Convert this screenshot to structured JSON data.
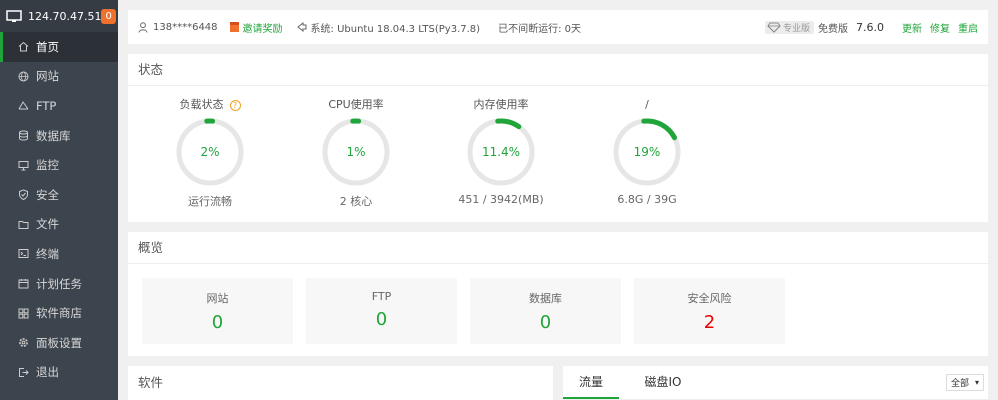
{
  "server": {
    "ip": "124.70.47.51",
    "badge": "0"
  },
  "sidebar": {
    "items": [
      {
        "label": "首页",
        "icon": "home-icon"
      },
      {
        "label": "网站",
        "icon": "globe-icon"
      },
      {
        "label": "FTP",
        "icon": "ftp-icon"
      },
      {
        "label": "数据库",
        "icon": "database-icon"
      },
      {
        "label": "监控",
        "icon": "monitor-icon"
      },
      {
        "label": "安全",
        "icon": "shield-icon"
      },
      {
        "label": "文件",
        "icon": "folder-icon"
      },
      {
        "label": "终端",
        "icon": "terminal-icon"
      },
      {
        "label": "计划任务",
        "icon": "calendar-icon"
      },
      {
        "label": "软件商店",
        "icon": "grid-icon"
      },
      {
        "label": "面板设置",
        "icon": "gear-icon"
      },
      {
        "label": "退出",
        "icon": "logout-icon"
      }
    ],
    "active_index": 0
  },
  "topbar": {
    "user": "138****6448",
    "invite": "邀请奖励",
    "system": "系统:  Ubuntu 18.04.3 LTS(Py3.7.8)",
    "uptime": "已不间断运行: 0天",
    "pro_badge": "专业版",
    "edition": "免费版",
    "version": "7.6.0",
    "update": "更新",
    "repair": "修复",
    "restart": "重启"
  },
  "status": {
    "title": "状态",
    "gauges": [
      {
        "title": "负载状态",
        "value": "2%",
        "percent": 2,
        "sub": "运行流畅",
        "help": "?"
      },
      {
        "title": "CPU使用率",
        "value": "1%",
        "percent": 1,
        "sub": "2 核心"
      },
      {
        "title": "内存使用率",
        "value": "11.4%",
        "percent": 11.4,
        "sub": "451 / 3942(MB)"
      },
      {
        "title": "/",
        "value": "19%",
        "percent": 19,
        "sub": "6.8G / 39G"
      }
    ]
  },
  "overview": {
    "title": "概览",
    "cards": [
      {
        "label": "网站",
        "value": "0",
        "color": "#20a53a"
      },
      {
        "label": "FTP",
        "value": "0",
        "color": "#20a53a"
      },
      {
        "label": "数据库",
        "value": "0",
        "color": "#20a53a"
      },
      {
        "label": "安全风险",
        "value": "2",
        "color": "#ee0000"
      }
    ]
  },
  "software": {
    "title": "软件"
  },
  "traffic": {
    "tabs": [
      "流量",
      "磁盘IO"
    ],
    "active_tab": 0,
    "select": "全部"
  },
  "colors": {
    "accent": "#20a53a",
    "sidebar": "#3c444d",
    "warning": "#f0712e"
  }
}
